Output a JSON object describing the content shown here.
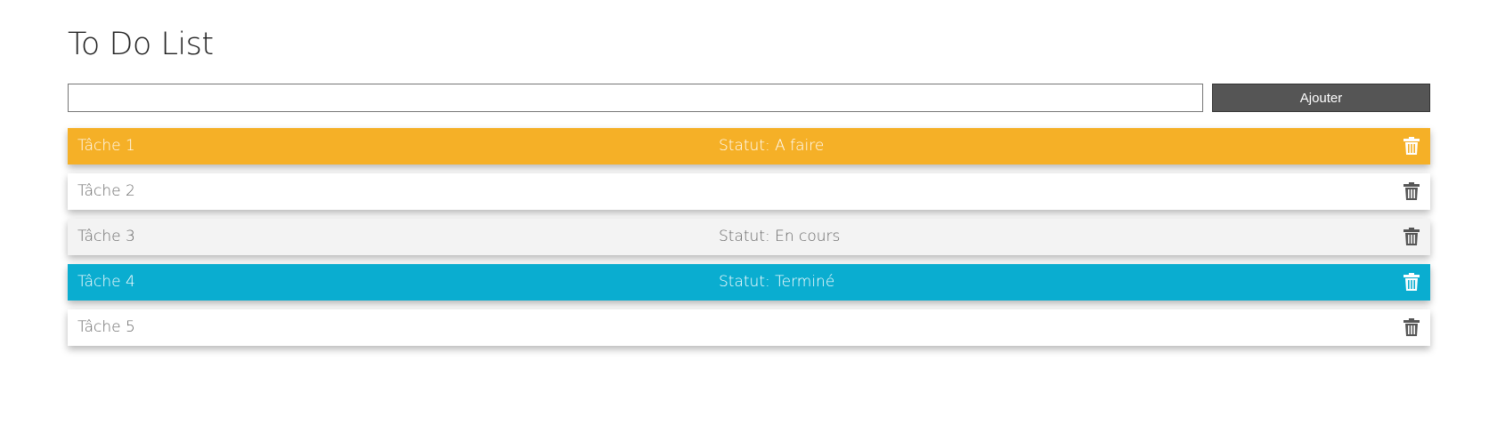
{
  "header": {
    "title": "To Do List"
  },
  "form": {
    "input_value": "",
    "input_placeholder": "",
    "add_label": "Ajouter"
  },
  "tasks": [
    {
      "name": "Tâche 1",
      "status_text": "Statut: A faire",
      "status": "todo",
      "color": "#f5b027",
      "delete_icon": "trash-icon"
    },
    {
      "name": "Tâche 2",
      "status_text": "",
      "status": "none",
      "color": "#ffffff",
      "delete_icon": "trash-icon"
    },
    {
      "name": "Tâche 3",
      "status_text": "Statut: En cours",
      "status": "doing",
      "color": "#f3f3f3",
      "delete_icon": "trash-icon"
    },
    {
      "name": "Tâche 4",
      "status_text": "Statut: Terminé",
      "status": "done",
      "color": "#0aadd0",
      "delete_icon": "trash-icon"
    },
    {
      "name": "Tâche 5",
      "status_text": "",
      "status": "none",
      "color": "#ffffff",
      "delete_icon": "trash-icon"
    }
  ],
  "colors": {
    "todo": "#f5b027",
    "done": "#0aadd0",
    "doing": "#f3f3f3",
    "button": "#555555"
  }
}
